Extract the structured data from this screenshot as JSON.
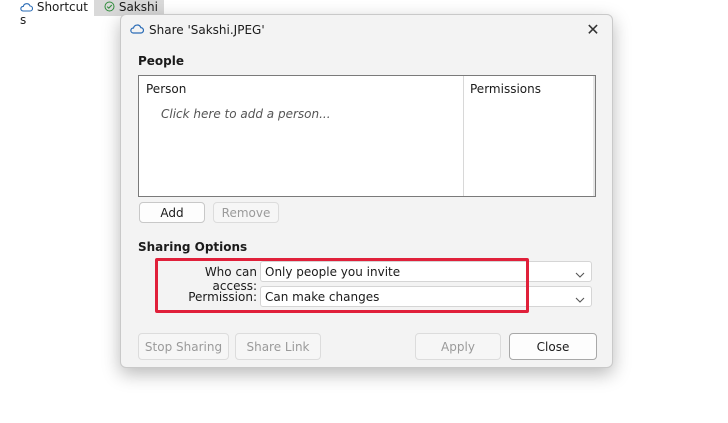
{
  "background": {
    "shortcuts_label": "Shortcut",
    "shortcuts_wrap": "s",
    "sakshi_label": "Sakshi"
  },
  "dialog": {
    "title": "Share 'Sakshi.JPEG'",
    "people": {
      "section_title": "People",
      "columns": [
        "Person",
        "Permissions"
      ],
      "placeholder": "Click here to add a person...",
      "add_label": "Add",
      "remove_label": "Remove"
    },
    "sharing_options": {
      "section_title": "Sharing Options",
      "who_can_access_label": "Who can access:",
      "who_can_access_value": "Only people you invite",
      "permission_label": "Permission:",
      "permission_value": "Can make changes"
    },
    "footer": {
      "stop_sharing_label": "Stop Sharing",
      "share_link_label": "Share Link",
      "apply_label": "Apply",
      "close_label": "Close"
    }
  },
  "colors": {
    "highlight": "#e0203a",
    "onedrive_blue": "#2b6cb6",
    "sync_green": "#2e8b3a"
  },
  "icons": {
    "title": "cloud-icon",
    "shortcuts": "cloud-icon",
    "sakshi": "sync-check-icon",
    "dropdown": "chevron-down-icon"
  }
}
